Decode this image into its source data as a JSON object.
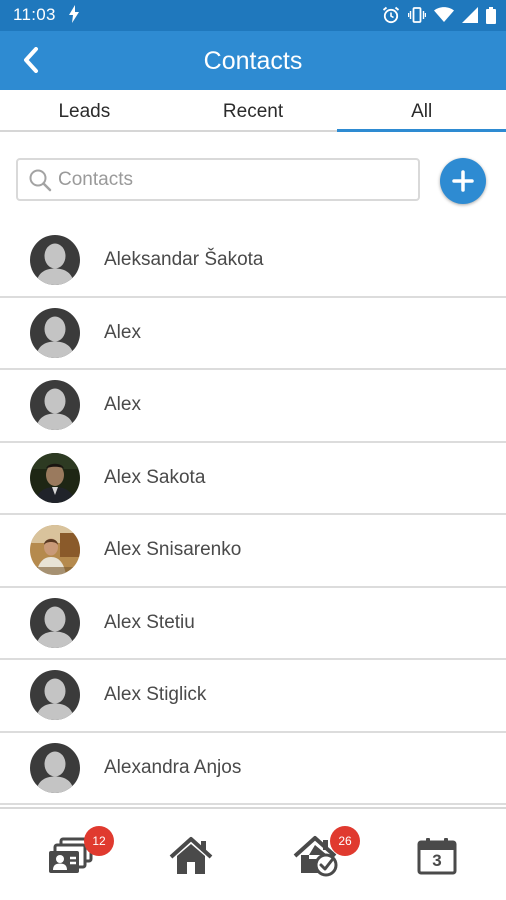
{
  "status_bar": {
    "time": "11:03"
  },
  "app_bar": {
    "title": "Contacts"
  },
  "tabs": [
    {
      "label": "Leads",
      "active": false
    },
    {
      "label": "Recent",
      "active": false
    },
    {
      "label": "All",
      "active": true
    }
  ],
  "search": {
    "placeholder": "Contacts",
    "value": ""
  },
  "contacts": [
    {
      "name": "Aleksandar Šakota",
      "avatar": "default-avatar-icon"
    },
    {
      "name": "Alex",
      "avatar": "default-avatar-icon"
    },
    {
      "name": "Alex",
      "avatar": "default-avatar-icon"
    },
    {
      "name": "Alex Sakota",
      "avatar": "photo"
    },
    {
      "name": "Alex Snisarenko",
      "avatar": "photo"
    },
    {
      "name": "Alex Stetiu",
      "avatar": "default-avatar-icon"
    },
    {
      "name": "Alex Stiglick",
      "avatar": "default-avatar-icon"
    },
    {
      "name": "Alexandra Anjos",
      "avatar": "default-avatar-icon"
    }
  ],
  "bottom_nav": [
    {
      "icon": "contacts-cards-icon",
      "badge": "12"
    },
    {
      "icon": "home-icon",
      "badge": ""
    },
    {
      "icon": "home-check-icon",
      "badge": "26"
    },
    {
      "icon": "calendar-icon",
      "label": "3",
      "badge": ""
    }
  ],
  "colors": {
    "status_bar": "#1f78bd",
    "app_bar": "#2e8bd2",
    "accent": "#2e8bd2",
    "badge": "#e03a2f",
    "divider": "#dcdcdc"
  }
}
